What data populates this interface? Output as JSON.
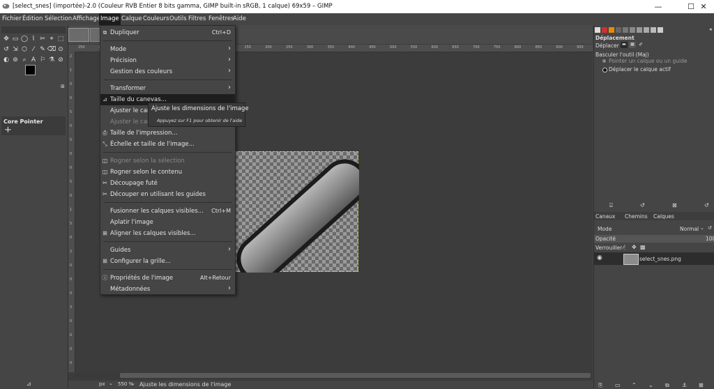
{
  "window": {
    "title": "[select_snes] (importée)-2.0 (Couleur RVB Entier 8 bits gamma, GIMP built-in sRGB, 1 calque) 69x59 – GIMP",
    "minimize": "—",
    "maximize": "☐",
    "close": "✕"
  },
  "menubar": [
    "Fichier",
    "Édition",
    "Sélection",
    "Affichage",
    "Image",
    "Calque",
    "Couleurs",
    "Outils",
    "Filtres",
    "Fenêtres",
    "Aide"
  ],
  "toolbox": {
    "tools": [
      "✥",
      "▭",
      "◯",
      "⌇",
      "✂",
      "⌖",
      "⬚",
      "↺",
      "⇲",
      "⬡",
      "⁄",
      "✎",
      "⌫",
      "⊙",
      "◐",
      "⊚",
      "⌕",
      "A",
      "⚐",
      "⚗",
      "⊘"
    ],
    "core_pointer": {
      "label": "Core Pointer",
      "icon": "+"
    }
  },
  "rulers": {
    "h": [
      "250",
      "200",
      "150",
      "100",
      "50",
      "0",
      "50",
      "100",
      "150",
      "200",
      "250",
      "300",
      "350",
      "400",
      "450",
      "500",
      "550",
      "600",
      "650",
      "700",
      "750",
      "800",
      "850",
      "900",
      "950"
    ],
    "v": [
      "2",
      "1",
      "0",
      "0",
      "5",
      "0",
      "5",
      "0",
      "0",
      "5",
      "0",
      "1",
      "5",
      "0",
      "2",
      "0",
      "0",
      "0",
      "3",
      "0",
      "0",
      "0",
      "0"
    ]
  },
  "statusbar": {
    "unit": "px",
    "zoom": "550 %",
    "message": "Ajuste les dimensions de l'image"
  },
  "menu": {
    "items": [
      {
        "label": "Dupliquer",
        "shortcut": "Ctrl+D",
        "icon": "⧉",
        "disabled": false
      },
      {
        "sep": true
      },
      {
        "label": "Mode",
        "submenu": true
      },
      {
        "label": "Précision",
        "submenu": true
      },
      {
        "label": "Gestion des couleurs",
        "submenu": true
      },
      {
        "sep": true
      },
      {
        "label": "Transformer",
        "submenu": true
      },
      {
        "label": "Taille du canevas...",
        "icon": "⊿",
        "highlight": true
      },
      {
        "label": "Ajuster le canevas aux calques"
      },
      {
        "label": "Ajuster le canevas à la sélection",
        "disabled": true
      },
      {
        "label": "Taille de l'impression...",
        "icon": "⎙"
      },
      {
        "label": "Échelle et taille de l'image...",
        "icon": "⤡"
      },
      {
        "sep": true
      },
      {
        "label": "Rogner selon la sélection",
        "icon": "◫",
        "disabled": true
      },
      {
        "label": "Rogner selon le contenu",
        "icon": "◫"
      },
      {
        "label": "Découpage futé",
        "icon": "✂"
      },
      {
        "label": "Découper en utilisant les guides",
        "icon": "✂"
      },
      {
        "sep": true
      },
      {
        "label": "Fusionner les calques visibles...",
        "shortcut": "Ctrl+M"
      },
      {
        "label": "Aplatir l'image"
      },
      {
        "label": "Aligner les calques visibles...",
        "icon": "⊞"
      },
      {
        "sep": true
      },
      {
        "label": "Guides",
        "submenu": true
      },
      {
        "label": "Configurer la grille...",
        "icon": "⊞"
      },
      {
        "sep": true
      },
      {
        "label": "Propriétés de l'image",
        "shortcut": "Alt+Retour",
        "icon": "ⓘ"
      },
      {
        "label": "Métadonnées",
        "submenu": true
      }
    ]
  },
  "tooltip": {
    "title": "Ajuste les dimensions de l'image",
    "hint": "Appuyez sur F1 pour obtenir de l'aide"
  },
  "tool_options": {
    "header": "Déplacement",
    "move_label": "Déplacer :",
    "toggle_label": "Basculer l'outil (Maj)",
    "option1": "Pointer un calque ou un guide",
    "option2": "Déplacer le calque actif"
  },
  "layers": {
    "tabs": [
      "Canaux",
      "Chemins",
      "Calques"
    ],
    "mode_label": "Mode",
    "mode_value": "Normal",
    "opacity_label": "Opacité",
    "opacity_value": "100",
    "lock_label": "Verrouiller :",
    "layer_name": "select_snes.png"
  },
  "colors": {
    "accent": "#1e1e1e",
    "panel": "#454545",
    "canvas": "#3c3c3c"
  }
}
